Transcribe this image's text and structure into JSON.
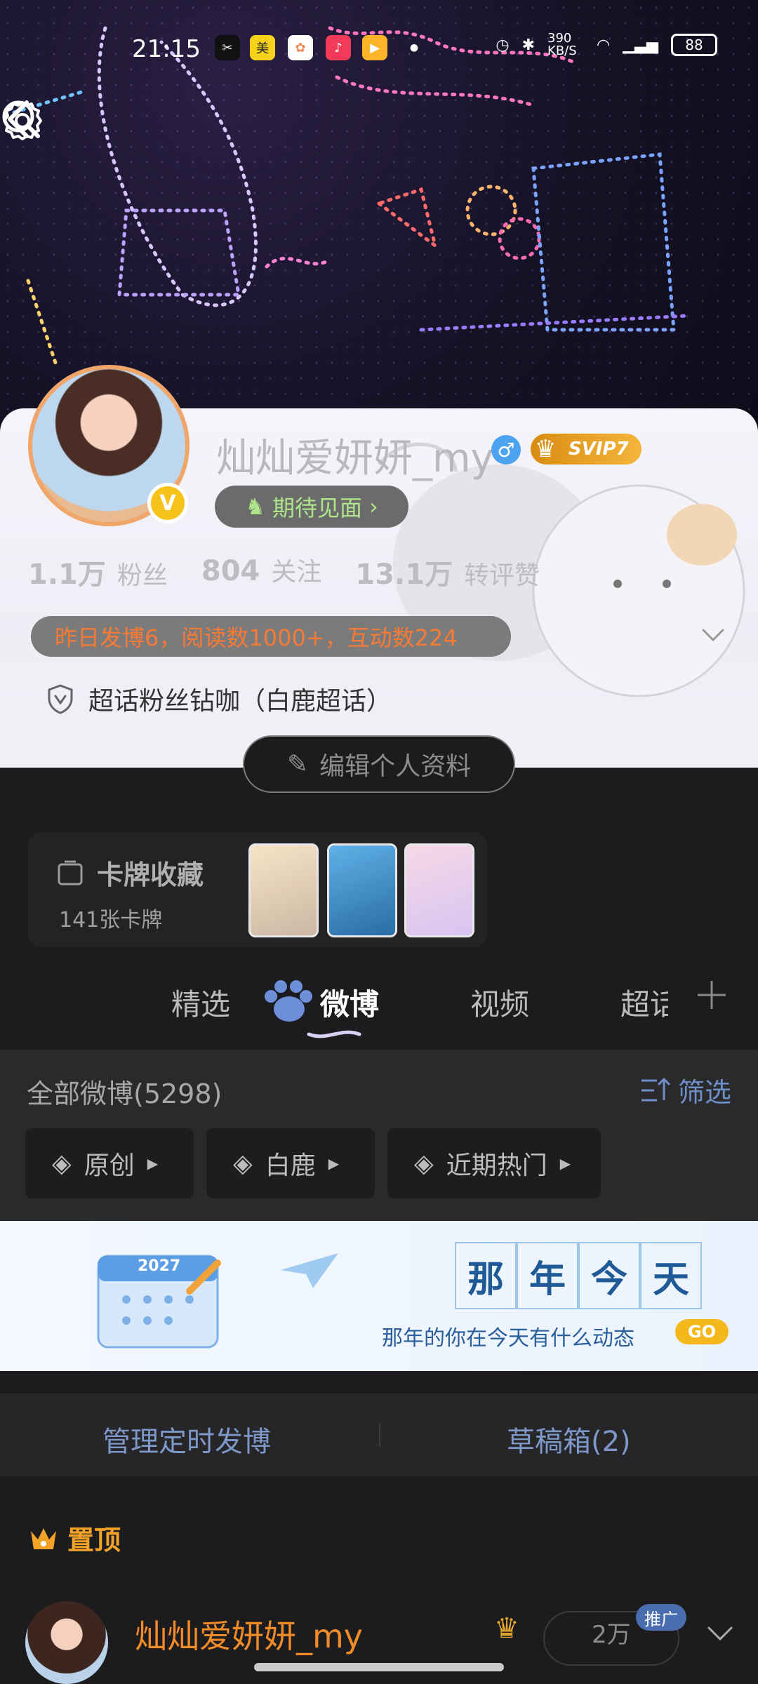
{
  "status_bar": {
    "time": "21:15",
    "apps": [
      "capcut-icon",
      "meituan-icon",
      "photos-icon",
      "music-icon",
      "video-icon"
    ],
    "network_speed": "390 KB/S",
    "battery": "88"
  },
  "profile": {
    "username": "灿灿爱妍妍_my",
    "vip": "SVIP7",
    "meet_button": "期待见面",
    "stats": [
      {
        "value": "1.1万",
        "label": "粉丝"
      },
      {
        "value": "804",
        "label": "关注"
      },
      {
        "value": "13.1万",
        "label": "转评赞"
      }
    ],
    "notice": "昨日发博6，阅读数1000+，互动数224",
    "super_topic": "超话粉丝钻咖（白鹿超话）",
    "edit_button": "编辑个人资料"
  },
  "card_collection": {
    "title": "卡牌收藏",
    "count": "141张卡牌"
  },
  "tabs": [
    "精选",
    "微博",
    "视频",
    "超话"
  ],
  "active_tab": "微博",
  "feed": {
    "all_label": "全部微博(5298)",
    "filter_label": "筛选",
    "chips": [
      "原创",
      "白鹿",
      "近期热门"
    ]
  },
  "promo": {
    "chars": [
      "那",
      "年",
      "今",
      "天"
    ],
    "subtitle": "那年的你在今天有什么动态",
    "go": "GO",
    "year": "2027"
  },
  "manage": {
    "scheduled": "管理定时发博",
    "drafts": "草稿箱(2)"
  },
  "pinned": {
    "label": "置顶",
    "author": "灿灿爱妍妍_my",
    "views": "2万",
    "ad_tag": "推广"
  },
  "colors": {
    "accent_orange": "#f28c28",
    "link_blue": "#6e8fc8",
    "svip_gold": "#e09a1e"
  }
}
